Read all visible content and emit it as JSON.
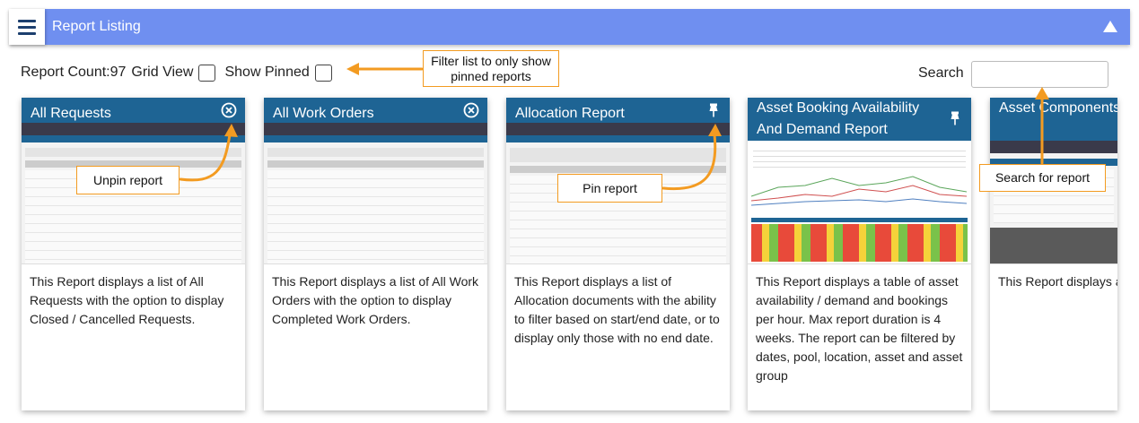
{
  "header": {
    "title": "Report Listing"
  },
  "toolbar": {
    "report_count": "Report Count:97",
    "grid_view_label": "Grid View",
    "show_pinned_label": "Show Pinned",
    "search_label": "Search",
    "search_value": ""
  },
  "cards": [
    {
      "title": "All Requests",
      "icon": "unpin-icon",
      "description": "This Report displays a list of All Requests with the option to display Closed / Cancelled Requests."
    },
    {
      "title": "All Work Orders",
      "icon": "unpin-icon",
      "description": "This Report displays a list of All Work Orders with the option to display Completed Work Orders."
    },
    {
      "title": "Allocation Report",
      "icon": "pin-icon",
      "description": "This Report displays a list of Allocation documents with the ability to filter based on start/end date, or to display only those with no end date."
    },
    {
      "title": "Asset Booking Availability And Demand Report",
      "icon": "pin-icon",
      "description": "This Report displays a table of asset availability / demand and bookings per hour. Max report duration is 4 weeks. The report can be filtered by dates, pool, location, asset and asset group"
    },
    {
      "title": "Asset Components",
      "icon": "pin-icon",
      "description": "This Report displays a list of Asset Components."
    }
  ],
  "callouts": {
    "filter": "Filter list to only show pinned reports",
    "unpin": "Unpin report",
    "pin": "Pin report",
    "search": "Search for report"
  },
  "colors": {
    "header_bar": "#6f8ff0",
    "card_header": "#1e6494",
    "callout_accent": "#f39b21"
  }
}
